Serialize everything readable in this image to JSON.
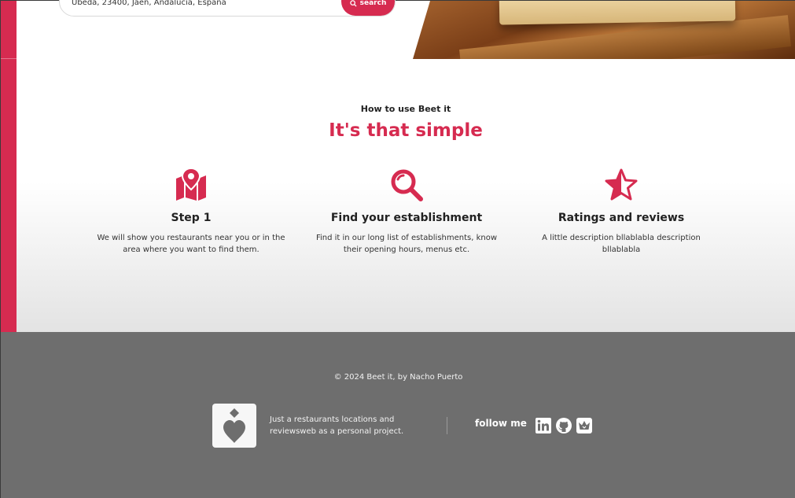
{
  "search": {
    "value": "Úbeda, 23400, Jaén, Andalucía, España",
    "button_label": "search"
  },
  "how_to": {
    "eyebrow": "How to use Beet it",
    "title": "It's that simple",
    "steps": [
      {
        "icon": "map-pin-icon",
        "title": "Step 1",
        "description": "We will show you restaurants near you or in the area where you want to find them."
      },
      {
        "icon": "magnifier-icon",
        "title": "Find your establishment",
        "description": "Find it in our long list of establishments, know their opening hours, menus etc."
      },
      {
        "icon": "star-icon",
        "title": "Ratings and reviews",
        "description": "A little description bllablabla description bllablabla"
      }
    ]
  },
  "footer": {
    "copyright": "© 2024 Beet it, by Nacho Puerto",
    "tagline": "Just a restaurants locations and reviewsweb as a personal project.",
    "follow_label": "follow me",
    "social_icons": [
      "linkedin-icon",
      "github-icon",
      "crown-icon"
    ]
  },
  "colors": {
    "accent": "#d62b50",
    "footer_bg": "#6e6e6e",
    "text_dark": "#222222"
  }
}
